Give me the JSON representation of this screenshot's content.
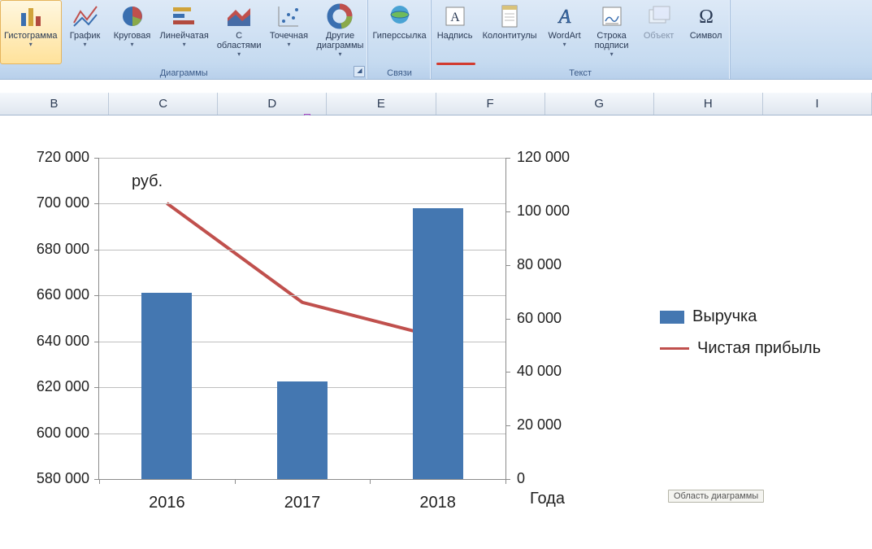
{
  "ribbon": {
    "groups": [
      {
        "title": "Диаграммы",
        "launcher": true,
        "buttons": [
          {
            "id": "histogram",
            "label": "Гистограмма",
            "dropdown": true
          },
          {
            "id": "line",
            "label": "График",
            "dropdown": true
          },
          {
            "id": "pie",
            "label": "Круговая",
            "dropdown": true
          },
          {
            "id": "bar",
            "label": "Линейчатая",
            "dropdown": true
          },
          {
            "id": "area",
            "label": "С\nобластями",
            "dropdown": true
          },
          {
            "id": "scatter",
            "label": "Точечная",
            "dropdown": true
          },
          {
            "id": "other",
            "label": "Другие\nдиаграммы",
            "dropdown": true
          }
        ]
      },
      {
        "title": "Связи",
        "buttons": [
          {
            "id": "hyperlink",
            "label": "Гиперссылка",
            "dropdown": false
          }
        ]
      },
      {
        "title": "Текст",
        "buttons": [
          {
            "id": "textbox",
            "label": "Надпись",
            "dropdown": false,
            "red_underline": true
          },
          {
            "id": "headerfooter",
            "label": "Колонтитулы",
            "dropdown": false
          },
          {
            "id": "wordart",
            "label": "WordArt",
            "dropdown": true
          },
          {
            "id": "sigline",
            "label": "Строка\nподписи",
            "dropdown": true
          },
          {
            "id": "object",
            "label": "Объект",
            "dropdown": false,
            "disabled": true
          },
          {
            "id": "symbol",
            "label": "Символ",
            "dropdown": false
          }
        ]
      }
    ]
  },
  "columns": [
    "B",
    "C",
    "D",
    "E",
    "F",
    "G",
    "H",
    "I"
  ],
  "chart": {
    "unit_annotation": "руб.",
    "x_title": "Года",
    "tooltip": "Область диаграммы",
    "legend": {
      "series1": "Выручка",
      "series2": "Чистая прибыль"
    },
    "colors": {
      "bar": "#4477b1",
      "line": "#c0504d",
      "grid": "#bfbfbf"
    }
  },
  "chart_data": {
    "type": "bar+line",
    "categories": [
      "2016",
      "2017",
      "2018"
    ],
    "series": [
      {
        "name": "Выручка",
        "axis": "left",
        "type": "bar",
        "values": [
          661000,
          622500,
          698000
        ]
      },
      {
        "name": "Чистая прибыль",
        "axis": "right",
        "type": "line",
        "values": [
          103000,
          66000,
          53000
        ]
      }
    ],
    "left_axis": {
      "min": 580000,
      "max": 720000,
      "step": 20000,
      "ticks": [
        "580 000",
        "600 000",
        "620 000",
        "640 000",
        "660 000",
        "680 000",
        "700 000",
        "720 000"
      ]
    },
    "right_axis": {
      "min": 0,
      "max": 120000,
      "step": 20000,
      "ticks": [
        "0",
        "20 000",
        "40 000",
        "60 000",
        "80 000",
        "100 000",
        "120 000"
      ]
    },
    "xlabel": "Года",
    "unit": "руб."
  }
}
